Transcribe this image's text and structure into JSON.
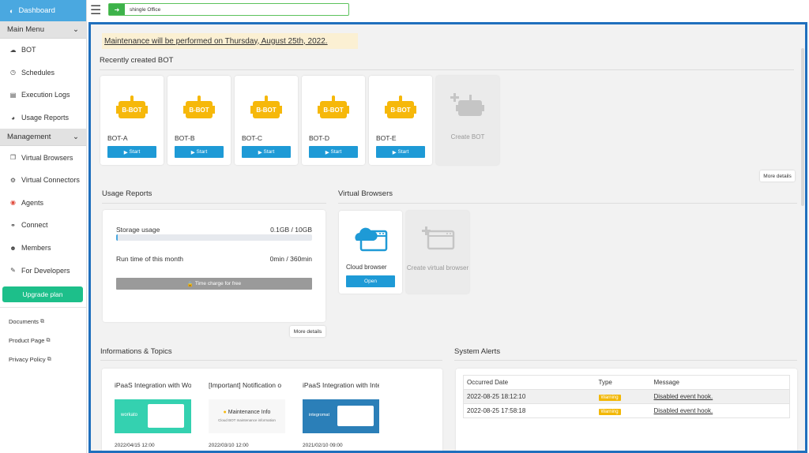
{
  "sidebar": {
    "dashboard": "Dashboard",
    "main_menu": "Main Menu",
    "main_items": [
      "BOT",
      "Schedules",
      "Execution Logs",
      "Usage Reports"
    ],
    "management": "Management",
    "management_items": [
      "Virtual Browsers",
      "Virtual Connectors",
      "Agents",
      "Connect",
      "Members",
      "For Developers"
    ],
    "upgrade": "Upgrade plan",
    "links": [
      "Documents",
      "Product Page",
      "Privacy Policy"
    ]
  },
  "topbar": {
    "office": "shingle Office"
  },
  "maintenance": "Maintenance will be performed on Thursday, August 25th, 2022.",
  "recent_bots": {
    "title": "Recently created BOT",
    "bots": [
      "BOT-A",
      "BOT-B",
      "BOT-C",
      "BOT-D",
      "BOT-E"
    ],
    "logo_text": "B-BOT",
    "start": "Start",
    "create": "Create BOT",
    "more": "More details"
  },
  "usage": {
    "title": "Usage Reports",
    "storage_label": "Storage usage",
    "storage_value": "0.1GB / 10GB",
    "storage_fraction": 0.01,
    "runtime_label": "Run time of this month",
    "runtime_value": "0min / 360min",
    "runtime_fraction": 0,
    "charge": "Time charge for free",
    "more": "More details"
  },
  "virtual_browsers": {
    "title": "Virtual Browsers",
    "cloud": "Cloud browser",
    "open": "Open",
    "create": "Create virtual browser"
  },
  "topics": {
    "title": "Informations & Topics",
    "items": [
      {
        "title": "iPaaS Integration with Wo",
        "date": "2022/04/15 12:00",
        "thumb": "workato"
      },
      {
        "title": "[Important] Notification o",
        "date": "2022/03/10 12:00",
        "thumb": "Maintenance Info"
      },
      {
        "title": "iPaaS Integration with Inte",
        "date": "2021/02/10 09:00",
        "thumb": "integromat"
      }
    ],
    "maint_sub": "Cloud BOT maintenance information"
  },
  "alerts": {
    "title": "System Alerts",
    "headers": [
      "Occurred Date",
      "Type",
      "Message"
    ],
    "rows": [
      {
        "date": "2022-08-25 18:12:10",
        "type": "Warning",
        "message": "Disabled event hook."
      },
      {
        "date": "2022-08-25 17:58:18",
        "type": "Warning",
        "message": "Disabled event hook."
      }
    ]
  },
  "colors": {
    "accent": "#1e9ad6",
    "frame": "#1f6fbd",
    "upgrade": "#1dbf8a",
    "bot_yellow": "#f6b80a",
    "warning": "#f2b705"
  }
}
